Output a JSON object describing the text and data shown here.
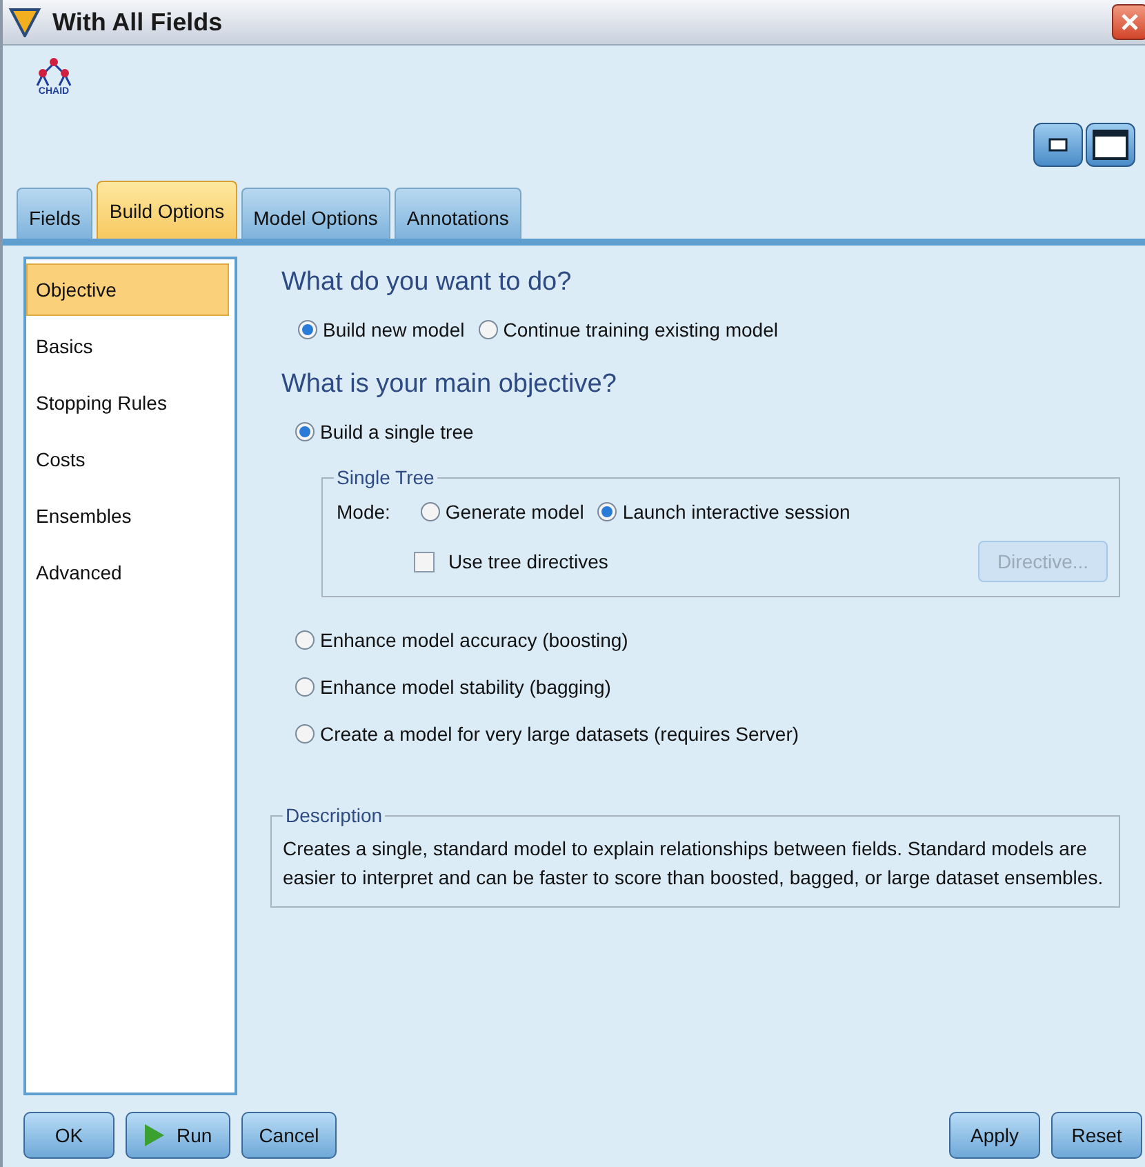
{
  "window": {
    "title": "With All Fields"
  },
  "node_icon": {
    "label": "CHAID"
  },
  "tabs": [
    {
      "label": "Fields",
      "selected": false
    },
    {
      "label": "Build Options",
      "selected": true
    },
    {
      "label": "Model Options",
      "selected": false
    },
    {
      "label": "Annotations",
      "selected": false
    }
  ],
  "sidebar": {
    "items": [
      {
        "label": "Objective",
        "selected": true
      },
      {
        "label": "Basics",
        "selected": false
      },
      {
        "label": "Stopping Rules",
        "selected": false
      },
      {
        "label": "Costs",
        "selected": false
      },
      {
        "label": "Ensembles",
        "selected": false
      },
      {
        "label": "Advanced",
        "selected": false
      }
    ]
  },
  "goal": {
    "heading": "What do you want to do?",
    "options": [
      {
        "label": "Build new model",
        "selected": true
      },
      {
        "label": "Continue training existing model",
        "selected": false
      }
    ]
  },
  "objective": {
    "heading": "What is your main objective?",
    "options": [
      {
        "label": "Build a single tree",
        "selected": true
      },
      {
        "label": "Enhance model accuracy (boosting)",
        "selected": false
      },
      {
        "label": "Enhance model stability (bagging)",
        "selected": false
      },
      {
        "label": "Create a model for very large datasets (requires Server)",
        "selected": false
      }
    ]
  },
  "single_tree": {
    "legend": "Single Tree",
    "mode_label": "Mode:",
    "modes": [
      {
        "label": "Generate model",
        "selected": false
      },
      {
        "label": "Launch interactive session",
        "selected": true
      }
    ],
    "directives": {
      "label": "Use tree directives",
      "checked": false
    },
    "directive_button": {
      "label": "Directive...",
      "disabled": true
    }
  },
  "description": {
    "legend": "Description",
    "text": "Creates a single, standard model to explain relationships between fields.  Standard models are easier to interpret and can be faster to score than boosted, bagged, or large dataset ensembles."
  },
  "footer": {
    "left": [
      {
        "label": "OK",
        "kind": "plain"
      },
      {
        "label": "Run",
        "kind": "run"
      },
      {
        "label": "Cancel",
        "kind": "plain"
      }
    ],
    "right": [
      {
        "label": "Apply"
      },
      {
        "label": "Reset"
      }
    ]
  }
}
